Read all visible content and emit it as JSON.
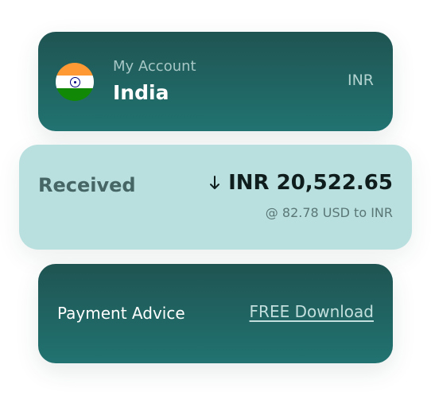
{
  "account": {
    "label": "My Account",
    "country": "India",
    "currency": "INR",
    "flag_icon": "india-flag-icon"
  },
  "received": {
    "label": "Received",
    "direction_icon": "arrow-down-icon",
    "amount": "INR 20,522.65",
    "rate": "@ 82.78 USD to INR"
  },
  "advice": {
    "label": "Payment Advice",
    "link": "FREE Download"
  },
  "colors": {
    "card_dark_top": "#1f5452",
    "card_dark_bottom": "#217371",
    "card_light": "#b9e0df",
    "amount_text": "#0f1d1d"
  }
}
